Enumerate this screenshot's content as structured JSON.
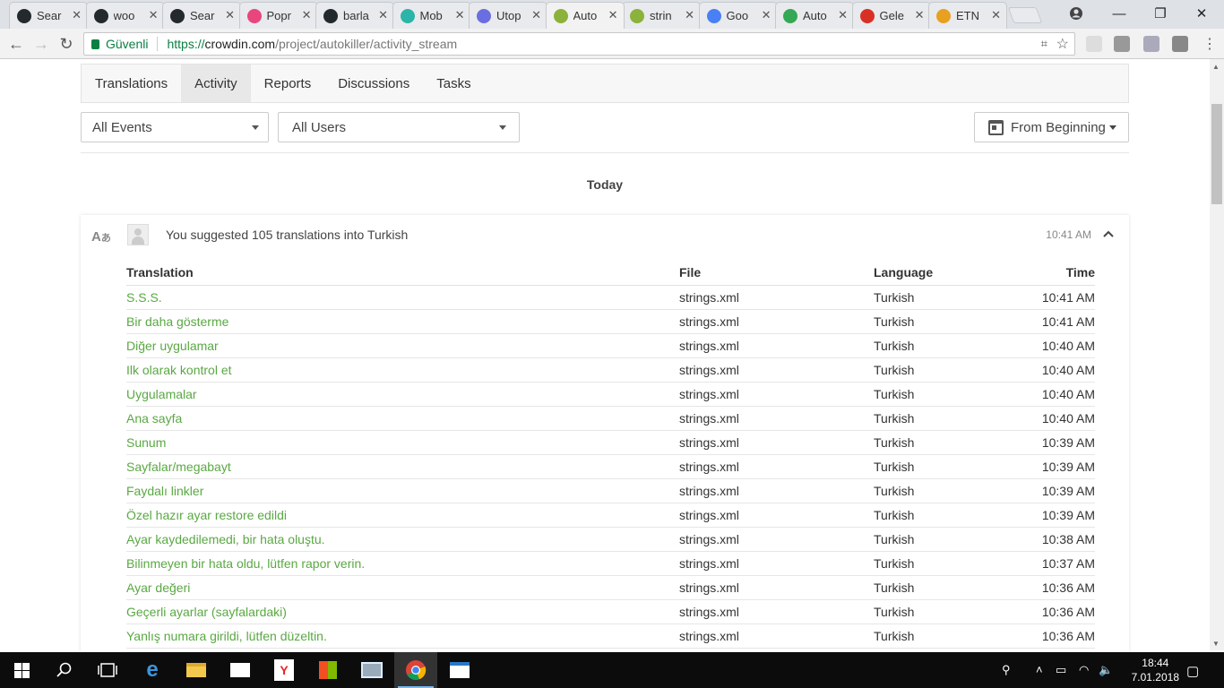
{
  "browser": {
    "tabs": [
      {
        "title": "Sear",
        "icon": "github-icon",
        "color": "#24292e"
      },
      {
        "title": "woo",
        "icon": "github-icon",
        "color": "#24292e"
      },
      {
        "title": "Sear",
        "icon": "github-icon",
        "color": "#24292e"
      },
      {
        "title": "Popr",
        "icon": "popr-icon",
        "color": "#e8467c"
      },
      {
        "title": "barla",
        "icon": "github-icon",
        "color": "#24292e"
      },
      {
        "title": "Mob",
        "icon": "mob-icon",
        "color": "#2bb5a8"
      },
      {
        "title": "Utop",
        "icon": "utopia-icon",
        "color": "#6b6ee0"
      },
      {
        "title": "Auto",
        "icon": "crowdin-icon",
        "color": "#8bb23a"
      },
      {
        "title": "strin",
        "icon": "crowdin-icon",
        "color": "#8bb23a"
      },
      {
        "title": "Goo",
        "icon": "google-translate-icon",
        "color": "#4a80f5"
      },
      {
        "title": "Auto",
        "icon": "play-store-icon",
        "color": "#34a853"
      },
      {
        "title": "Gele",
        "icon": "gmail-icon",
        "color": "#d93025"
      },
      {
        "title": "ETN",
        "icon": "etn-icon",
        "color": "#e8a020"
      }
    ],
    "active_tab_index": 7,
    "secure_label": "Güvenli",
    "url": {
      "scheme": "https://",
      "host": "crowdin.com",
      "path": "/project/autokiller/activity_stream"
    }
  },
  "page": {
    "nav_tabs": [
      "Translations",
      "Activity",
      "Reports",
      "Discussions",
      "Tasks"
    ],
    "active_nav": 1,
    "filters": {
      "events": "All Events",
      "users": "All Users",
      "date": "From Beginning"
    },
    "day_label": "Today",
    "activity": {
      "summary": "You suggested 105 translations into Turkish",
      "time": "10:41 AM",
      "columns": [
        "Translation",
        "File",
        "Language",
        "Time"
      ],
      "rows": [
        [
          "S.S.S.",
          "strings.xml",
          "Turkish",
          "10:41 AM"
        ],
        [
          "Bir daha gösterme",
          "strings.xml",
          "Turkish",
          "10:41 AM"
        ],
        [
          "Diğer uygulamar",
          "strings.xml",
          "Turkish",
          "10:40 AM"
        ],
        [
          "Ilk olarak kontrol et",
          "strings.xml",
          "Turkish",
          "10:40 AM"
        ],
        [
          "Uygulamalar",
          "strings.xml",
          "Turkish",
          "10:40 AM"
        ],
        [
          "Ana sayfa",
          "strings.xml",
          "Turkish",
          "10:40 AM"
        ],
        [
          "Sunum",
          "strings.xml",
          "Turkish",
          "10:39 AM"
        ],
        [
          "Sayfalar/megabayt",
          "strings.xml",
          "Turkish",
          "10:39 AM"
        ],
        [
          "Faydalı linkler",
          "strings.xml",
          "Turkish",
          "10:39 AM"
        ],
        [
          "Özel hazır ayar restore edildi",
          "strings.xml",
          "Turkish",
          "10:39 AM"
        ],
        [
          "Ayar kaydedilemedi, bir hata oluştu.",
          "strings.xml",
          "Turkish",
          "10:38 AM"
        ],
        [
          "Bilinmeyen bir hata oldu, lütfen rapor verin.",
          "strings.xml",
          "Turkish",
          "10:37 AM"
        ],
        [
          "Ayar değeri",
          "strings.xml",
          "Turkish",
          "10:36 AM"
        ],
        [
          "Geçerli ayarlar (sayfalardaki)",
          "strings.xml",
          "Turkish",
          "10:36 AM"
        ],
        [
          "Yanlış numara girildi, lütfen düzeltin.",
          "strings.xml",
          "Turkish",
          "10:36 AM"
        ]
      ]
    }
  },
  "taskbar": {
    "time": "18:44",
    "date": "7.01.2018"
  }
}
